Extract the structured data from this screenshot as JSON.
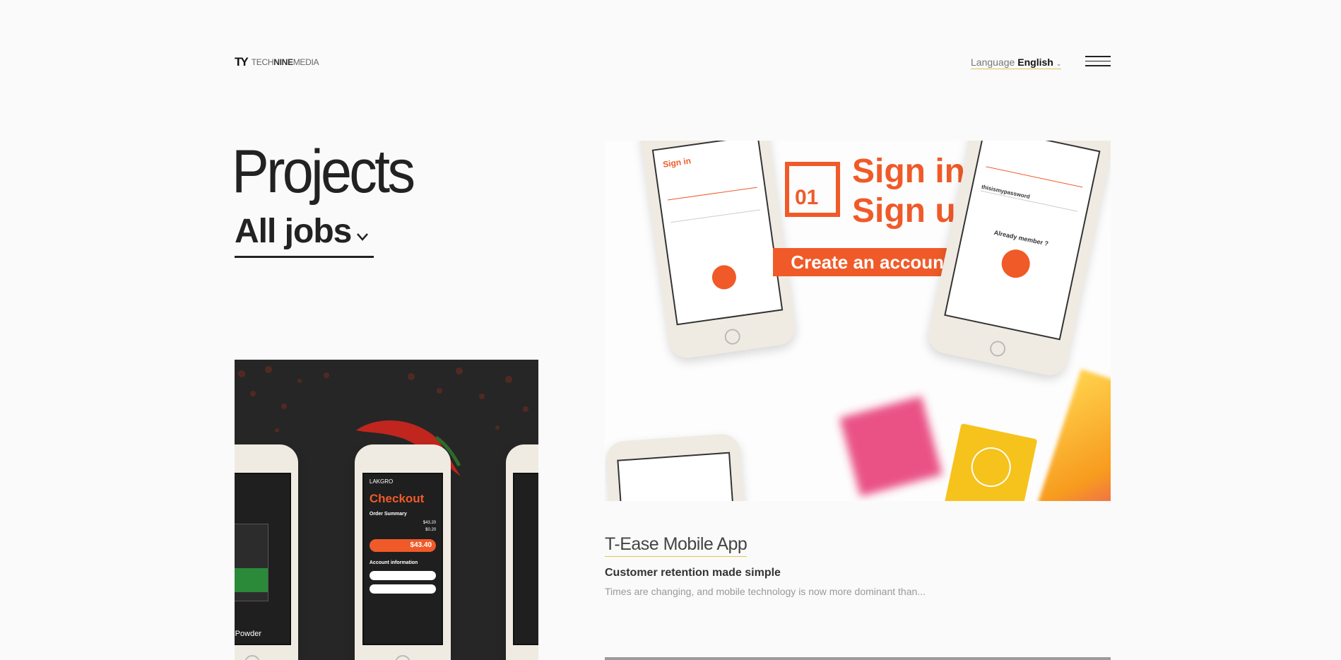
{
  "header": {
    "logo_mark": "TY",
    "logo_text_prefix": "TECH",
    "logo_text_bold": "NINE",
    "logo_text_suffix": "MEDIA",
    "language_label": "Language",
    "language_value": "English",
    "menu_icon": "hamburger-icon"
  },
  "page": {
    "title": "Projects",
    "filter_label": "All jobs"
  },
  "featured": {
    "title": "T-Ease Mobile App",
    "subtitle": "Customer retention made simple",
    "description": "Times are changing, and mobile technology is now more dominant than..."
  },
  "mockup_right": {
    "badge_number": "01",
    "line1": "Sign in",
    "line2": "Sign up",
    "cta": "Create an account",
    "screen1_heading": "Sign in",
    "screen2_password": "thisismypassword",
    "screen2_already": "Already member ?"
  },
  "mockup_left": {
    "brand": "LAKGRO",
    "checkout": "Checkout",
    "order_summary": "Order Summary",
    "price1": "$43.20",
    "price2": "$0.20",
    "total": "$43.40",
    "account": "Account information",
    "product": "oves Powder"
  },
  "colors": {
    "accent_orange": "#f05a28",
    "underline_gold": "#e2c259",
    "text_dark": "#222222"
  }
}
